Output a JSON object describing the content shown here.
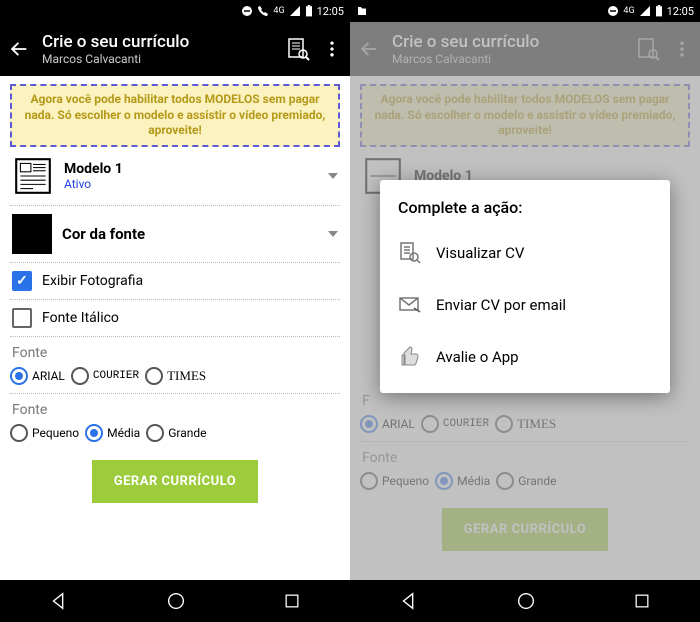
{
  "status": {
    "time": "12:05",
    "signal": "4G"
  },
  "appbar": {
    "title": "Crie o seu currículo",
    "subtitle": "Marcos Calvacanti"
  },
  "banner": "Agora você pode habilitar todos MODELOS sem pagar nada. Só escolher o modelo e assistir o vídeo premiado, aproveite!",
  "model": {
    "name": "Modelo 1",
    "status": "Ativo"
  },
  "fontcolor_label": "Cor da fonte",
  "show_photo_label": "Exibir Fotografia",
  "italic_label": "Fonte Itálico",
  "font_section": "Fonte",
  "fonts": {
    "arial": "ARIAL",
    "courier": "COURIER",
    "times": "TIMES"
  },
  "size_section": "Fonte",
  "sizes": {
    "small": "Pequeno",
    "medium": "Média",
    "large": "Grande"
  },
  "generate_label": "GERAR CURRÍCULO",
  "dialog": {
    "title": "Complete a ação:",
    "view": "Visualizar CV",
    "email": "Enviar CV por email",
    "rate": "Avalie o App"
  }
}
